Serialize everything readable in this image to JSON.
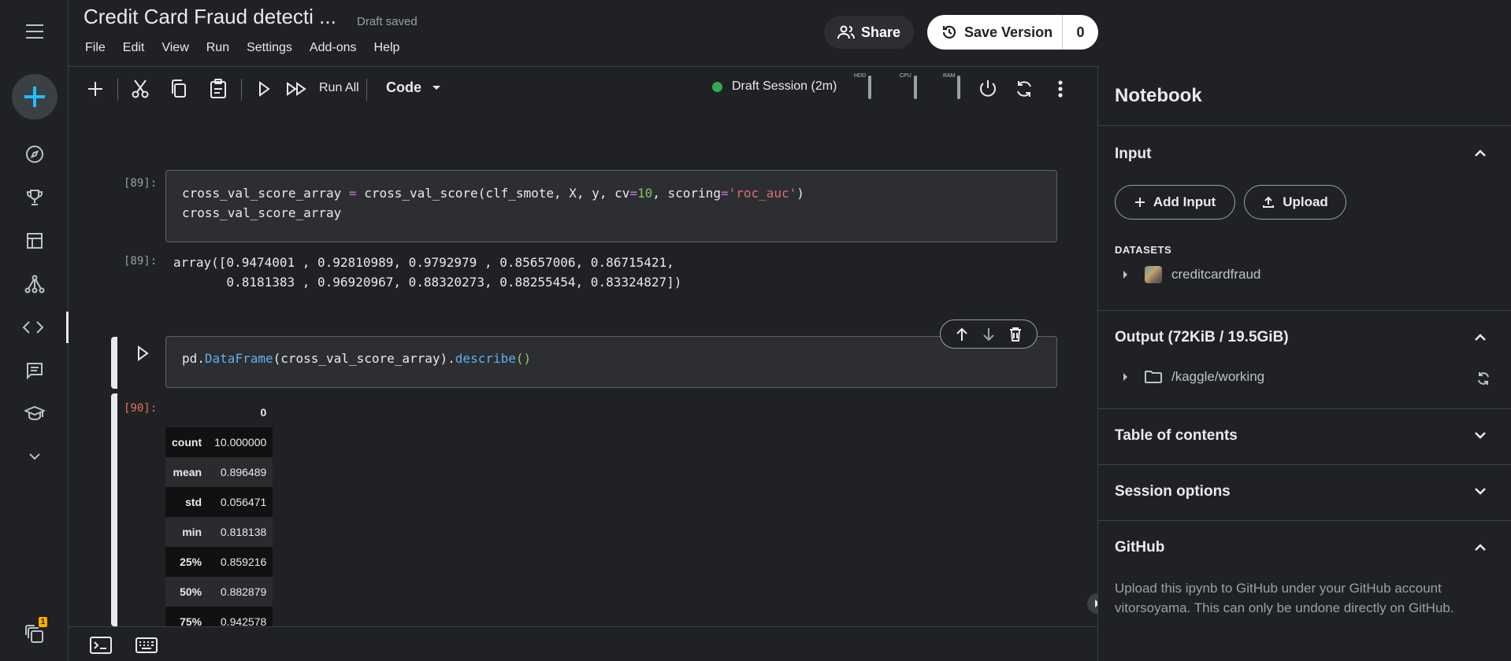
{
  "header": {
    "title": "Credit Card Fraud detecti ...",
    "status": "Draft saved",
    "menu": [
      "File",
      "Edit",
      "View",
      "Run",
      "Settings",
      "Add-ons",
      "Help"
    ],
    "share_label": "Share",
    "save_version_label": "Save Version",
    "version_count": "0"
  },
  "toolbar": {
    "run_all_label": "Run All",
    "cell_type": "Code",
    "session_label": "Draft Session (2m)",
    "meters": [
      "HDD",
      "CPU",
      "RAM"
    ]
  },
  "cells": {
    "cell1": {
      "prompt": "[89]:",
      "output_prompt": "[89]:",
      "code_line1_parts": [
        "cross_val_score_array ",
        "=",
        " cross_val_score(clf_smote, X, y, cv",
        "=",
        "10",
        ", scoring",
        "=",
        "'roc_auc'",
        ")"
      ],
      "code_line2": "cross_val_score_array",
      "output_line1": "array([0.9474001 , 0.92810989, 0.9792979 , 0.85657006, 0.86715421,",
      "output_line2": "       0.8181383 , 0.96920967, 0.88320273, 0.88255454, 0.83324827])"
    },
    "cell2": {
      "code_parts": [
        "pd.",
        "DataFrame",
        "(cross_val_score_array).",
        "describe",
        "()"
      ],
      "output_prompt": "[90]:",
      "table_header": "0",
      "table_rows": [
        {
          "label": "count",
          "value": "10.000000"
        },
        {
          "label": "mean",
          "value": "0.896489"
        },
        {
          "label": "std",
          "value": "0.056471"
        },
        {
          "label": "min",
          "value": "0.818138"
        },
        {
          "label": "25%",
          "value": "0.859216"
        },
        {
          "label": "50%",
          "value": "0.882879"
        },
        {
          "label": "75%",
          "value": "0.942578"
        }
      ]
    }
  },
  "panel": {
    "title": "Notebook",
    "input": {
      "heading": "Input",
      "add_input_label": "Add Input",
      "upload_label": "Upload",
      "datasets_caption": "DATASETS",
      "dataset_name": "creditcardfraud"
    },
    "output": {
      "heading": "Output (72KiB / 19.5GiB)",
      "folder": "/kaggle/working"
    },
    "toc_heading": "Table of contents",
    "session_heading": "Session options",
    "github": {
      "heading": "GitHub",
      "text": "Upload this ipynb to GitHub under your GitHub account vitorsoyama. This can only be undone directly on GitHub."
    }
  },
  "rail": {
    "notification_count": "1"
  },
  "colors": {
    "accent_blue": "#20beff",
    "session_green": "#34a853",
    "badge_yellow": "#f9ab00"
  }
}
